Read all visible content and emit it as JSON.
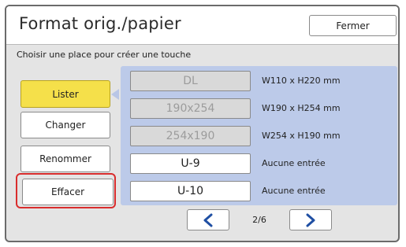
{
  "header": {
    "title": "Format orig./papier",
    "close_label": "Fermer"
  },
  "instruction": "Choisir une place pour créer une touche",
  "actions": {
    "list_label": "Lister",
    "change_label": "Changer",
    "rename_label": "Renommer",
    "delete_label": "Effacer"
  },
  "slots": [
    {
      "name": "DL",
      "size": "W110 x H220 mm",
      "enabled": false
    },
    {
      "name": "190x254",
      "size": "W190 x H254 mm",
      "enabled": false
    },
    {
      "name": "254x190",
      "size": "W254 x H190 mm",
      "enabled": false
    },
    {
      "name": "U-9",
      "size": "Aucune entrée",
      "enabled": true
    },
    {
      "name": "U-10",
      "size": "Aucune entrée",
      "enabled": true
    }
  ],
  "pagination": {
    "page": "2/6"
  },
  "colors": {
    "selected_button": "#f5e04a",
    "panel": "#bccae9",
    "highlight": "#d92d2d",
    "nav_arrow": "#1f4fa3"
  },
  "icons": {
    "prev": "chevron-left-icon",
    "next": "chevron-right-icon"
  }
}
